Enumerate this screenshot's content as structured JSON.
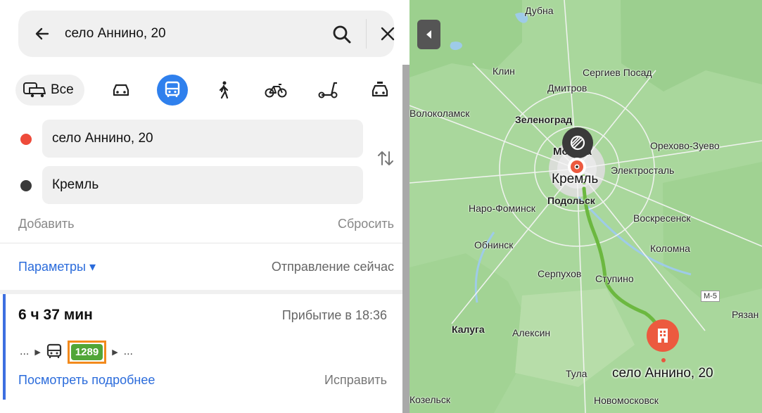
{
  "search": {
    "query": "село Аннино, 20"
  },
  "modes": {
    "all_label": "Все"
  },
  "route": {
    "from": "село Аннино, 20",
    "to": "Кремль",
    "add_label": "Добавить",
    "reset_label": "Сбросить",
    "params_label": "Параметры ▾",
    "departure": "Отправление сейчас"
  },
  "result": {
    "duration": "6 ч 37 мин",
    "arrival": "Прибытие в 18:36",
    "ellipsis_before": "...",
    "bus_number": "1289",
    "ellipsis_after": "...",
    "details_label": "Посмотреть подробнее",
    "fix_label": "Исправить"
  },
  "map": {
    "cities": [
      "Дубна",
      "Клин",
      "Сергиев Посад",
      "Дмитров",
      "Волоколамск",
      "Зеленоград",
      "Москва",
      "Орехово-Зуево",
      "Электросталь",
      "Подольск",
      "Наро-Фоминск",
      "Воскресенск",
      "Обнинск",
      "Коломна",
      "Серпухов",
      "Ступино",
      "Калуга",
      "Алексин",
      "Тула",
      "Новомосковск",
      "Козельск",
      "Рязан"
    ],
    "pin_kremlin": "Кремль",
    "pin_destination": "село Аннино, 20",
    "highway": "M-5",
    "route_color": "#6cb840",
    "pin_color": "#ec5a3f"
  }
}
